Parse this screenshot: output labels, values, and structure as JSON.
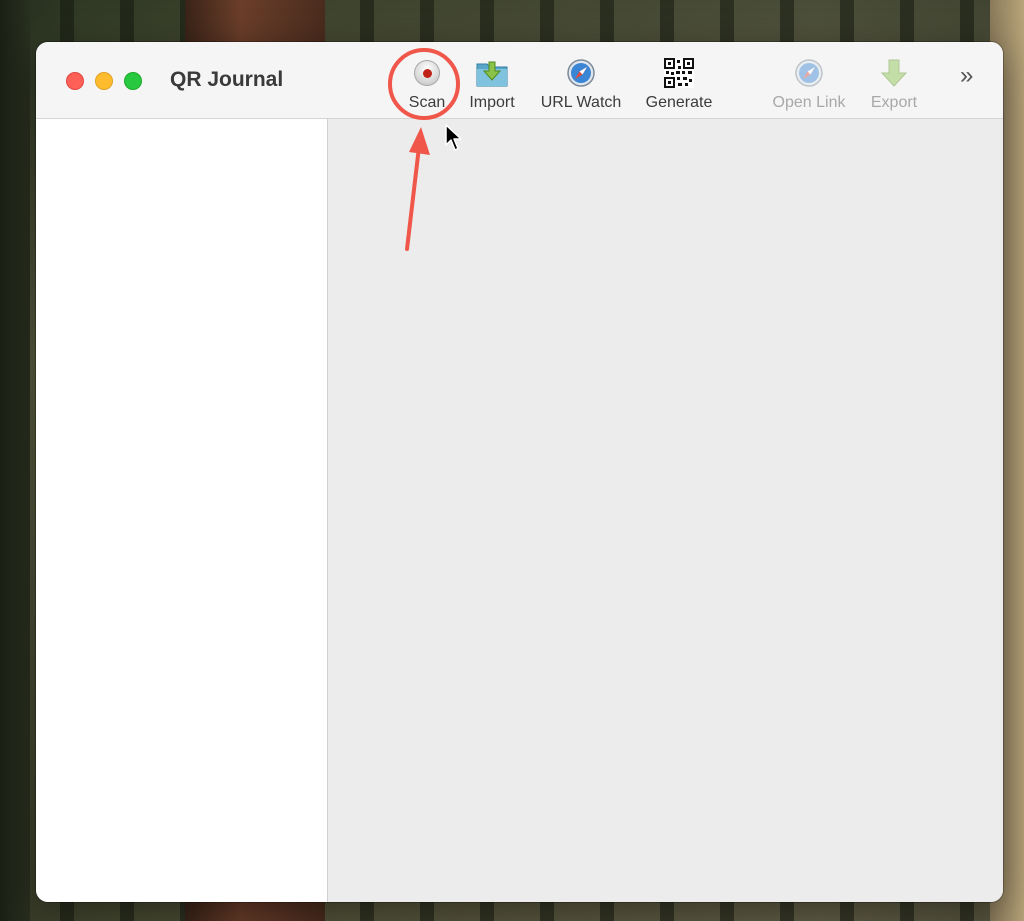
{
  "window": {
    "title": "QR Journal"
  },
  "toolbar": {
    "items": [
      {
        "label": "Scan",
        "icon": "scan-record-icon",
        "enabled": true
      },
      {
        "label": "Import",
        "icon": "import-folder-icon",
        "enabled": true
      },
      {
        "label": "URL Watch",
        "icon": "compass-icon",
        "enabled": true
      },
      {
        "label": "Generate",
        "icon": "qr-code-icon",
        "enabled": true
      },
      {
        "label": "Open Link",
        "icon": "compass-icon",
        "enabled": false
      },
      {
        "label": "Export",
        "icon": "export-arrow-icon",
        "enabled": false
      }
    ],
    "overflow_glyph": "»"
  },
  "annotation": {
    "color": "#f0574a",
    "target": "Scan"
  },
  "colors": {
    "close": "#fe5f57",
    "minimize": "#febc2e",
    "maximize": "#28c840",
    "scan_dot": "#c0221a"
  }
}
